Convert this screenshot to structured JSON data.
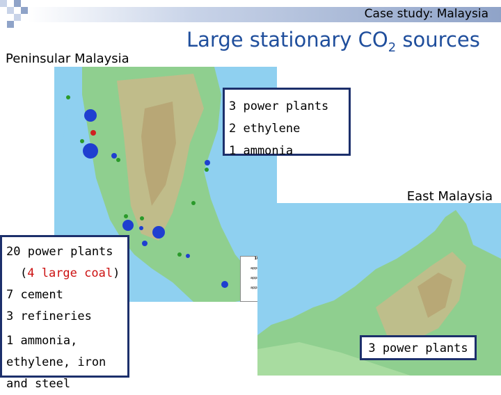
{
  "header": {
    "case_title": "Case study: Malaysia",
    "main_title_prefix": "Large stationary CO",
    "main_title_subscript": "2",
    "main_title_suffix": " sources"
  },
  "regions": {
    "peninsular_label": "Peninsular Malaysia",
    "east_label": "East Malaysia"
  },
  "peninsular_top_box": {
    "line1": "3 power plants",
    "line2": "2 ethylene",
    "line3": "1 ammonia"
  },
  "peninsular_left_box": {
    "line1": "20 power plants",
    "line2_open": "(",
    "line2_red": "4 large coal",
    "line2_close": ")",
    "line3": "7 cement",
    "line4": "3 refineries",
    "line5a": "1 ammonia,",
    "line5b": "ethylene, iron",
    "line5c": "and steel"
  },
  "east_box": {
    "line1": "3 power plants"
  },
  "legend": {
    "title": "100km",
    "row1": "approx. 500",
    "row2": "approx. 10500",
    "row3": "approx. 18500"
  },
  "colors": {
    "title_blue": "#1f4e9c",
    "box_border": "#1c2f6b",
    "emphasis_red": "#cc1111",
    "sea": "#8fd0f0",
    "land_green": "#8fcf8f",
    "highland": "#c9b98a"
  }
}
